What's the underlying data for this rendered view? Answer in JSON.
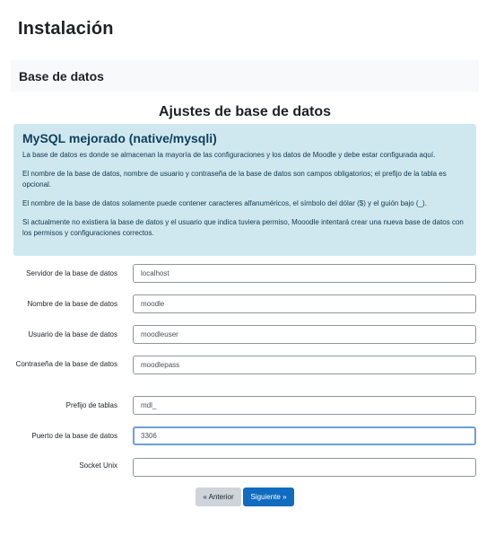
{
  "page": {
    "title": "Instalación"
  },
  "stage": {
    "title": "Base de datos"
  },
  "section": {
    "title": "Ajustes de base de datos"
  },
  "info": {
    "heading": "MySQL mejorado (native/mysqli)",
    "paragraphs": [
      "La base de datos es donde se almacenan la mayoría de las configuraciones y los datos de Moodle y debe estar configurada aquí.",
      "El nombre de la base de datos, nombre de usuario y contraseña de la base de datos son campos obligatorios; el prefijo de la tabla es opcional.",
      "El nombre de la base de datos solamente puede contener caracteres alfanuméricos, el símbolo del dólar ($) y el guión bajo (_).",
      "Si actualmente no existiera la base de datos y el usuario que indica tuviera permiso, Mooodle intentará crear una nueva base de datos con los permisos y configuraciones correctos."
    ],
    "bg_color": "#cfe8ef"
  },
  "form": {
    "fields": [
      {
        "label": "Servidor de la base de datos",
        "value": "localhost"
      },
      {
        "label": "Nombre de la base de datos",
        "value": "moodle"
      },
      {
        "label": "Usuario de la base de datos",
        "value": "moodleuser"
      },
      {
        "label": "Contraseña de la base de datos",
        "value": "moodlepass"
      },
      {
        "label": "Prefijo de tablas",
        "value": "mdl_"
      },
      {
        "label": "Puerto de la base de datos",
        "value": "3306"
      },
      {
        "label": "Socket Unix",
        "value": ""
      }
    ],
    "focused_field": "Puerto de la base de datos"
  },
  "buttons": {
    "back_label": "« Anterior",
    "next_label": "Siguiente »",
    "primary_color": "#0f6cbf",
    "secondary_color": "#ced4da"
  }
}
